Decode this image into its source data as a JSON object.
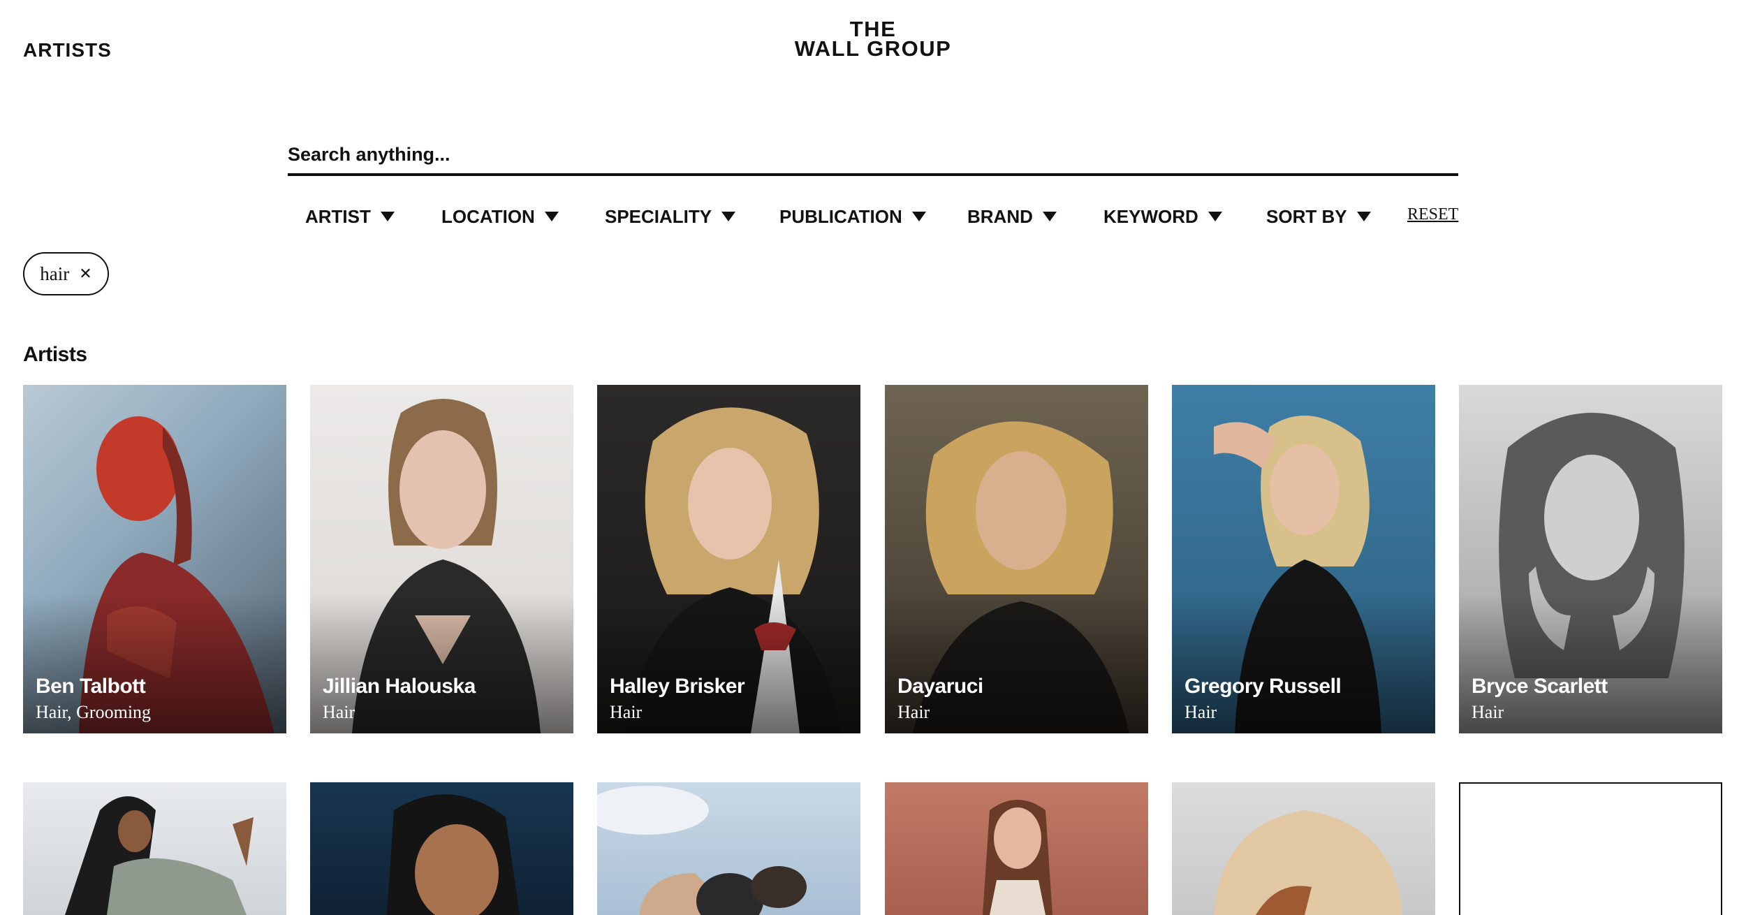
{
  "nav": {
    "artists_link": "ARTISTS"
  },
  "logo": {
    "line1": "THE",
    "line2": "WALL GROUP"
  },
  "search": {
    "placeholder": "Search anything..."
  },
  "filters": [
    {
      "label": "ARTIST"
    },
    {
      "label": "LOCATION"
    },
    {
      "label": "SPECIALITY"
    },
    {
      "label": "PUBLICATION"
    },
    {
      "label": "BRAND"
    },
    {
      "label": "KEYWORD"
    },
    {
      "label": "SORT BY"
    }
  ],
  "reset_label": "RESET",
  "active_filter": {
    "label": "hair"
  },
  "section_title": "Artists",
  "artists": [
    {
      "name": "Ben Talbott",
      "role": "Hair, Grooming"
    },
    {
      "name": "Jillian Halouska",
      "role": "Hair"
    },
    {
      "name": "Halley Brisker",
      "role": "Hair"
    },
    {
      "name": "Dayaruci",
      "role": "Hair"
    },
    {
      "name": "Gregory Russell",
      "role": "Hair"
    },
    {
      "name": "Bryce Scarlett",
      "role": "Hair"
    }
  ]
}
